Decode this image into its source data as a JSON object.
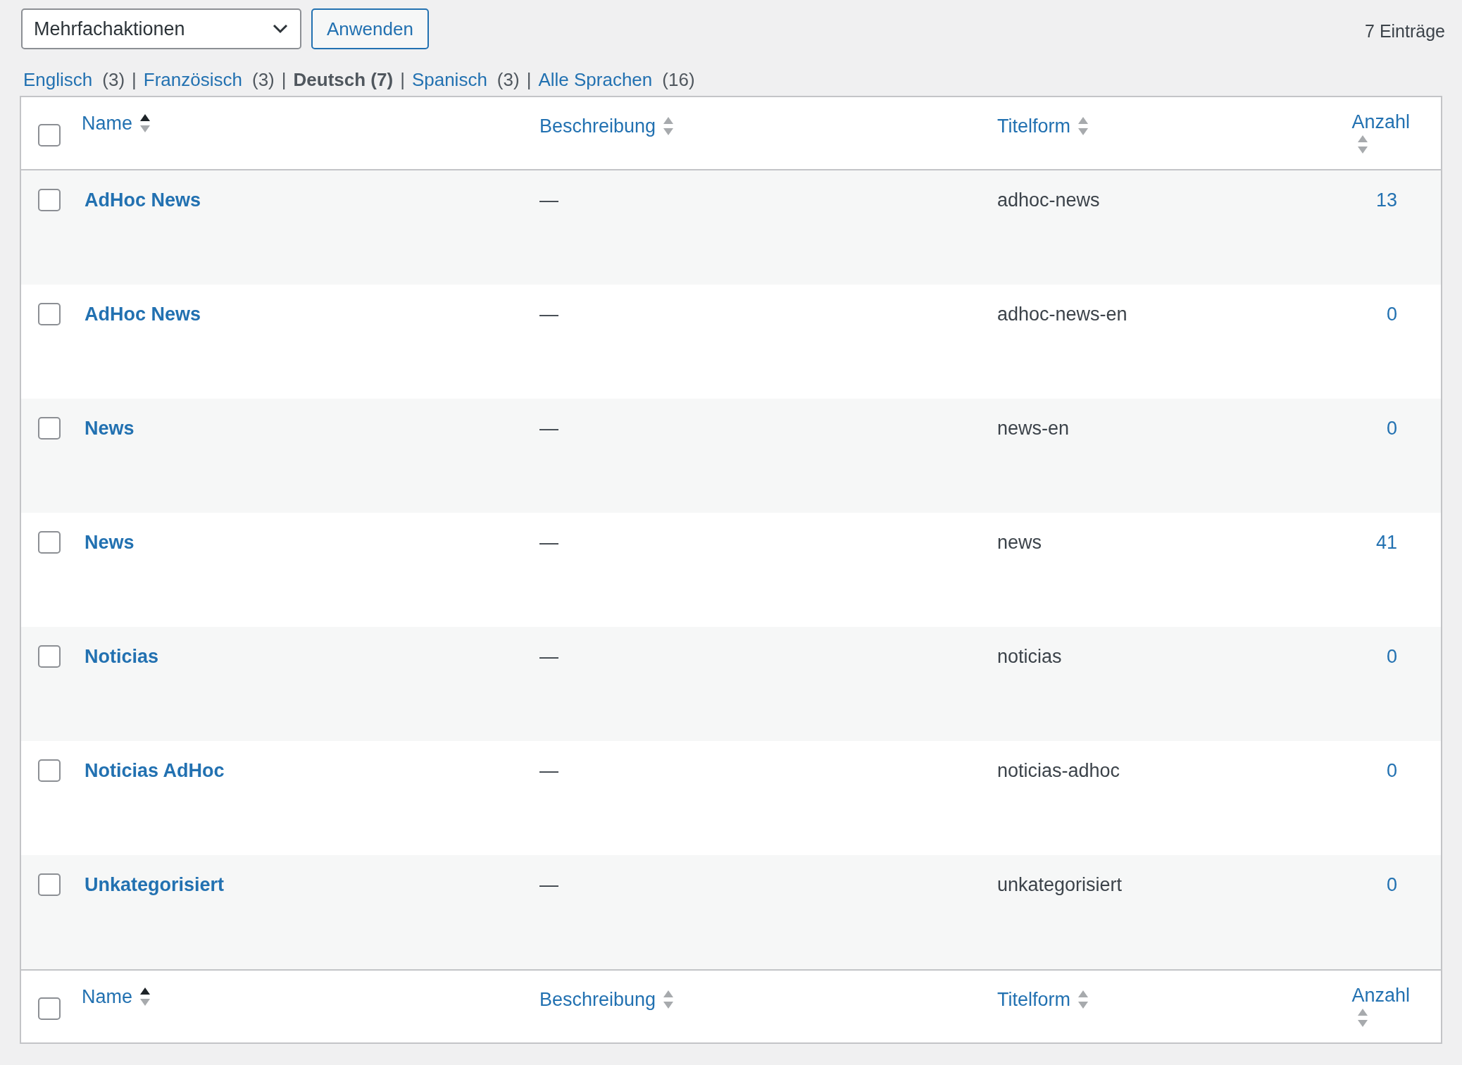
{
  "bulk_actions": {
    "value": "Mehrfachaktionen",
    "button": "Anwenden"
  },
  "item_count": "7 Einträge",
  "language_filters": [
    {
      "label": "Englisch",
      "count": "(3)",
      "selected": false,
      "separator": "|"
    },
    {
      "label": "Französisch",
      "count": "(3)",
      "selected": false,
      "separator": "|"
    },
    {
      "label": "Deutsch",
      "count": "(7)",
      "selected": true,
      "separator": "|"
    },
    {
      "label": "Spanisch",
      "count": "(3)",
      "selected": false,
      "separator": "|"
    },
    {
      "label": "Alle Sprachen",
      "count": "(16)",
      "selected": false
    }
  ],
  "table": {
    "select_all_checked": false,
    "columns": [
      {
        "label": "Name",
        "sorted": true
      },
      {
        "label": "Beschreibung",
        "sorted": false
      },
      {
        "label": "Titelform",
        "sorted": false
      },
      {
        "label": "Anzahl",
        "sorted": false
      }
    ],
    "rows": [
      {
        "checked": false,
        "name": "AdHoc News",
        "description": "—",
        "slug": "adhoc-news",
        "count": "13"
      },
      {
        "checked": false,
        "name": "AdHoc News",
        "description": "—",
        "slug": "adhoc-news-en",
        "count": "0"
      },
      {
        "checked": false,
        "name": "News",
        "description": "—",
        "slug": "news-en",
        "count": "0"
      },
      {
        "checked": false,
        "name": "News",
        "description": "—",
        "slug": "news",
        "count": "41"
      },
      {
        "checked": false,
        "name": "Noticias",
        "description": "—",
        "slug": "noticias",
        "count": "0"
      },
      {
        "checked": false,
        "name": "Noticias AdHoc",
        "description": "—",
        "slug": "noticias-adhoc",
        "count": "0"
      },
      {
        "checked": false,
        "name": "Unkategorisiert",
        "description": "—",
        "slug": "unkategorisiert",
        "count": "0"
      }
    ],
    "footer_columns": [
      {
        "label": "Name",
        "sorted": true
      },
      {
        "label": "Beschreibung",
        "sorted": false
      },
      {
        "label": "Titelform",
        "sorted": false
      },
      {
        "label": "Anzahl",
        "sorted": false
      }
    ],
    "footer_select_all_checked": false
  }
}
